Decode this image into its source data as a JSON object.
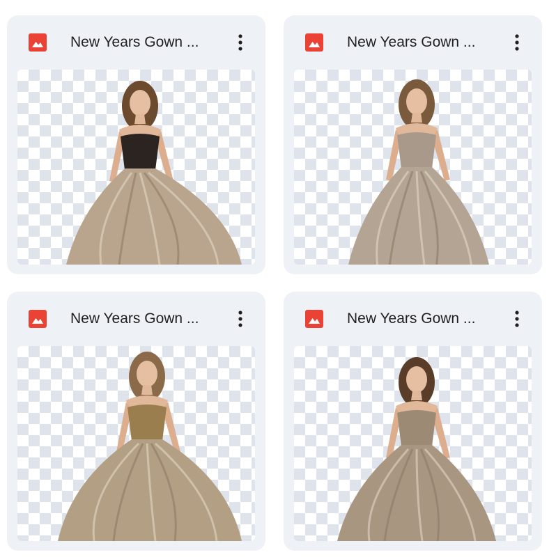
{
  "files": [
    {
      "name": "New Years Gown ...",
      "icon": "image-file-icon",
      "menu_icon": "more-vert-icon",
      "bodice": "#2b2420",
      "skirt": "#b9a58e",
      "hair": "#6b4a2e"
    },
    {
      "name": "New Years Gown ...",
      "icon": "image-file-icon",
      "menu_icon": "more-vert-icon",
      "bodice": "#a8998a",
      "skirt": "#b3a493",
      "hair": "#7a5a3c"
    },
    {
      "name": "New Years Gown ...",
      "icon": "image-file-icon",
      "menu_icon": "more-vert-icon",
      "bodice": "#9a7e4e",
      "skirt": "#b39f84",
      "hair": "#8a6a48"
    },
    {
      "name": "New Years Gown ...",
      "icon": "image-file-icon",
      "menu_icon": "more-vert-icon",
      "bodice": "#9c8a74",
      "skirt": "#a99680",
      "hair": "#5a3d28"
    }
  ],
  "colors": {
    "card_bg": "#eef1f6",
    "icon_red": "#ea4335",
    "text": "#1f1f1f",
    "checker": "#dfe4ec"
  }
}
